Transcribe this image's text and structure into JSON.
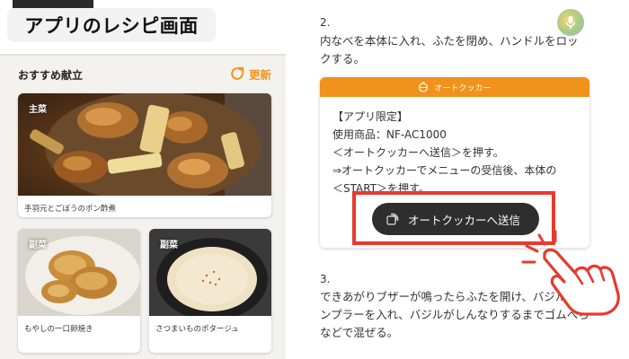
{
  "caption": "アプリのレシピ画面",
  "recommended": {
    "title": "おすすめ献立",
    "refresh_label": "更新",
    "cards": [
      {
        "tag": "主菜",
        "name": "手羽元とごぼうのポン酢煮"
      },
      {
        "tag": "副菜",
        "name": "もやしの一口卵焼き"
      },
      {
        "tag": "副菜",
        "name": "さつまいものポタージュ"
      }
    ]
  },
  "recipe": {
    "step2": {
      "number": "2.",
      "text": "内なべを本体に入れ、ふたを閉め、ハンドルをロックする。"
    },
    "autocooker": {
      "header": "オートクッカー",
      "lines": [
        "【アプリ限定】",
        "使用商品：NF-AC1000",
        "＜オートクッカーへ送信＞を押す。",
        "⇒オートクッカーでメニューの受信後、本体の",
        "＜START＞を押す。"
      ],
      "send_button": "オートクッカーへ送信"
    },
    "step3": {
      "number": "3.",
      "text": "できあがりブザーが鳴ったらふたを開け、バジルとナンプラーを入れ、バジルがしんなりするまでゴムべらなどで混ぜる。"
    }
  },
  "icons": {
    "refresh": "refresh-icon",
    "mic": "microphone-icon",
    "pot": "pot-icon",
    "send": "wireless-send-icon",
    "hand": "tapping-hand-icon"
  },
  "colors": {
    "accent_orange": "#f0921c",
    "highlight_red": "#e63a2e",
    "button_dark": "#2e2e2e"
  }
}
